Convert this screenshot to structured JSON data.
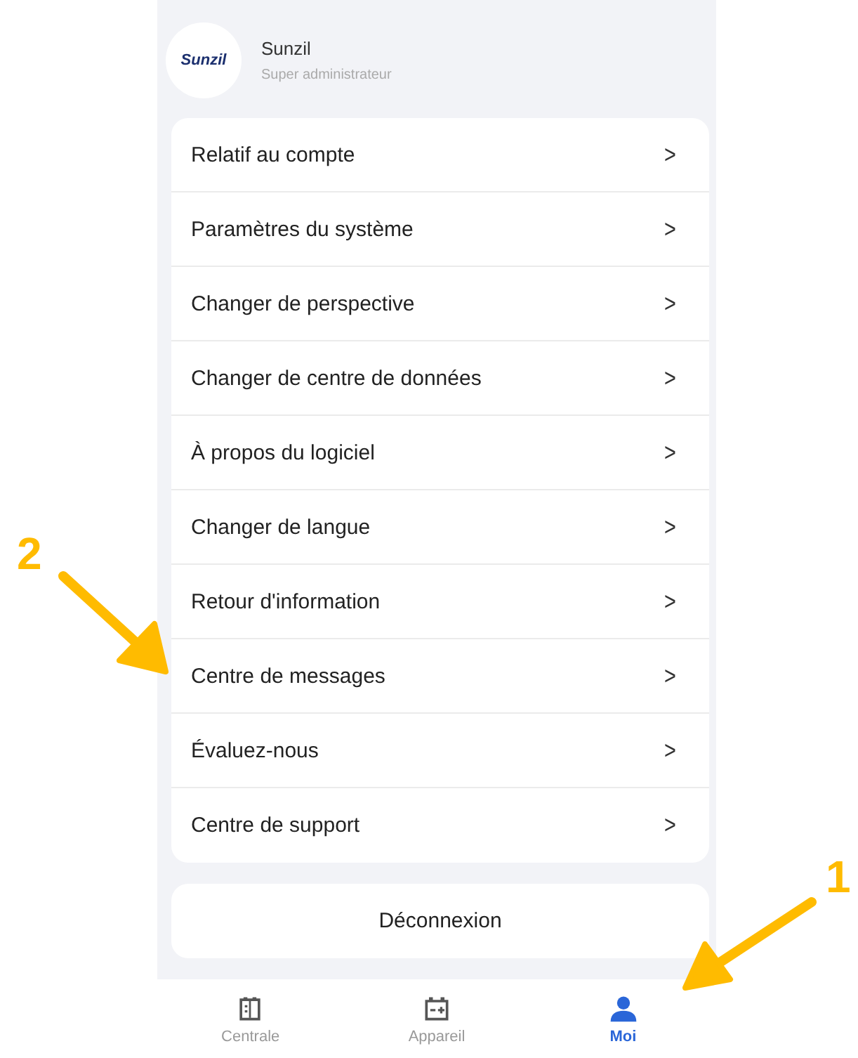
{
  "profile": {
    "logo_text": "Sunzil",
    "name": "Sunzil",
    "role": "Super administrateur"
  },
  "menu": [
    {
      "label": "Relatif au compte",
      "chevron": ">"
    },
    {
      "label": "Paramètres du système",
      "chevron": ">"
    },
    {
      "label": "Changer de perspective",
      "chevron": ">"
    },
    {
      "label": "Changer de centre de données",
      "chevron": ">"
    },
    {
      "label": "À propos du logiciel",
      "chevron": ">"
    },
    {
      "label": "Changer de langue",
      "chevron": ">"
    },
    {
      "label": "Retour d'information",
      "chevron": ">"
    },
    {
      "label": "Centre de messages",
      "chevron": ">"
    },
    {
      "label": "Évaluez-nous",
      "chevron": ">"
    },
    {
      "label": "Centre de support",
      "chevron": ">"
    }
  ],
  "logout": "Déconnexion",
  "nav": [
    {
      "label": "Centrale",
      "kind": "plant",
      "selected": false
    },
    {
      "label": "Appareil",
      "kind": "device",
      "selected": false
    },
    {
      "label": "Moi",
      "kind": "person",
      "selected": true
    }
  ],
  "annotations": [
    {
      "label": "2"
    },
    {
      "label": "1"
    }
  ]
}
